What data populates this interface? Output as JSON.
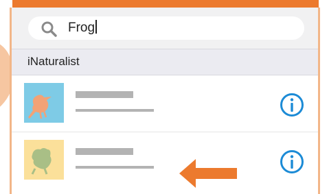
{
  "search": {
    "query": "Frog",
    "icon": "search-icon"
  },
  "section": {
    "title": "iNaturalist"
  },
  "results": [
    {
      "thumbnail": "bird-icon",
      "action_icon": "info-icon"
    },
    {
      "thumbnail": "frog-icon",
      "action_icon": "info-icon"
    }
  ],
  "colors": {
    "accent": "#ec7a2e",
    "info_blue": "#1c8bd6",
    "placeholder_gray": "#b3b3b3",
    "thumb_1_bg": "#7ecbe6",
    "thumb_2_bg": "#fbe09a"
  }
}
